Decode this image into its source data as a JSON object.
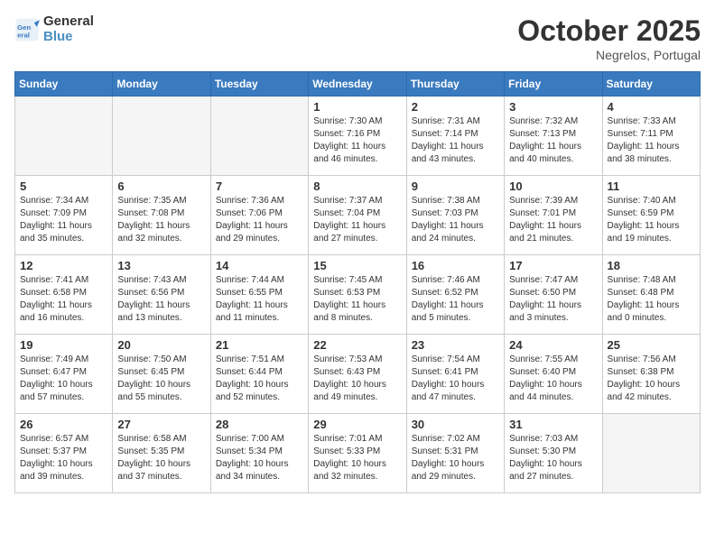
{
  "logo": {
    "line1": "General",
    "line2": "Blue"
  },
  "title": "October 2025",
  "location": "Negrelos, Portugal",
  "weekdays": [
    "Sunday",
    "Monday",
    "Tuesday",
    "Wednesday",
    "Thursday",
    "Friday",
    "Saturday"
  ],
  "weeks": [
    [
      {
        "day": "",
        "info": "",
        "empty": true
      },
      {
        "day": "",
        "info": "",
        "empty": true
      },
      {
        "day": "",
        "info": "",
        "empty": true
      },
      {
        "day": "1",
        "info": "Sunrise: 7:30 AM\nSunset: 7:16 PM\nDaylight: 11 hours\nand 46 minutes."
      },
      {
        "day": "2",
        "info": "Sunrise: 7:31 AM\nSunset: 7:14 PM\nDaylight: 11 hours\nand 43 minutes."
      },
      {
        "day": "3",
        "info": "Sunrise: 7:32 AM\nSunset: 7:13 PM\nDaylight: 11 hours\nand 40 minutes."
      },
      {
        "day": "4",
        "info": "Sunrise: 7:33 AM\nSunset: 7:11 PM\nDaylight: 11 hours\nand 38 minutes."
      }
    ],
    [
      {
        "day": "5",
        "info": "Sunrise: 7:34 AM\nSunset: 7:09 PM\nDaylight: 11 hours\nand 35 minutes."
      },
      {
        "day": "6",
        "info": "Sunrise: 7:35 AM\nSunset: 7:08 PM\nDaylight: 11 hours\nand 32 minutes."
      },
      {
        "day": "7",
        "info": "Sunrise: 7:36 AM\nSunset: 7:06 PM\nDaylight: 11 hours\nand 29 minutes."
      },
      {
        "day": "8",
        "info": "Sunrise: 7:37 AM\nSunset: 7:04 PM\nDaylight: 11 hours\nand 27 minutes."
      },
      {
        "day": "9",
        "info": "Sunrise: 7:38 AM\nSunset: 7:03 PM\nDaylight: 11 hours\nand 24 minutes."
      },
      {
        "day": "10",
        "info": "Sunrise: 7:39 AM\nSunset: 7:01 PM\nDaylight: 11 hours\nand 21 minutes."
      },
      {
        "day": "11",
        "info": "Sunrise: 7:40 AM\nSunset: 6:59 PM\nDaylight: 11 hours\nand 19 minutes."
      }
    ],
    [
      {
        "day": "12",
        "info": "Sunrise: 7:41 AM\nSunset: 6:58 PM\nDaylight: 11 hours\nand 16 minutes."
      },
      {
        "day": "13",
        "info": "Sunrise: 7:43 AM\nSunset: 6:56 PM\nDaylight: 11 hours\nand 13 minutes."
      },
      {
        "day": "14",
        "info": "Sunrise: 7:44 AM\nSunset: 6:55 PM\nDaylight: 11 hours\nand 11 minutes."
      },
      {
        "day": "15",
        "info": "Sunrise: 7:45 AM\nSunset: 6:53 PM\nDaylight: 11 hours\nand 8 minutes."
      },
      {
        "day": "16",
        "info": "Sunrise: 7:46 AM\nSunset: 6:52 PM\nDaylight: 11 hours\nand 5 minutes."
      },
      {
        "day": "17",
        "info": "Sunrise: 7:47 AM\nSunset: 6:50 PM\nDaylight: 11 hours\nand 3 minutes."
      },
      {
        "day": "18",
        "info": "Sunrise: 7:48 AM\nSunset: 6:48 PM\nDaylight: 11 hours\nand 0 minutes."
      }
    ],
    [
      {
        "day": "19",
        "info": "Sunrise: 7:49 AM\nSunset: 6:47 PM\nDaylight: 10 hours\nand 57 minutes."
      },
      {
        "day": "20",
        "info": "Sunrise: 7:50 AM\nSunset: 6:45 PM\nDaylight: 10 hours\nand 55 minutes."
      },
      {
        "day": "21",
        "info": "Sunrise: 7:51 AM\nSunset: 6:44 PM\nDaylight: 10 hours\nand 52 minutes."
      },
      {
        "day": "22",
        "info": "Sunrise: 7:53 AM\nSunset: 6:43 PM\nDaylight: 10 hours\nand 49 minutes."
      },
      {
        "day": "23",
        "info": "Sunrise: 7:54 AM\nSunset: 6:41 PM\nDaylight: 10 hours\nand 47 minutes."
      },
      {
        "day": "24",
        "info": "Sunrise: 7:55 AM\nSunset: 6:40 PM\nDaylight: 10 hours\nand 44 minutes."
      },
      {
        "day": "25",
        "info": "Sunrise: 7:56 AM\nSunset: 6:38 PM\nDaylight: 10 hours\nand 42 minutes."
      }
    ],
    [
      {
        "day": "26",
        "info": "Sunrise: 6:57 AM\nSunset: 5:37 PM\nDaylight: 10 hours\nand 39 minutes."
      },
      {
        "day": "27",
        "info": "Sunrise: 6:58 AM\nSunset: 5:35 PM\nDaylight: 10 hours\nand 37 minutes."
      },
      {
        "day": "28",
        "info": "Sunrise: 7:00 AM\nSunset: 5:34 PM\nDaylight: 10 hours\nand 34 minutes."
      },
      {
        "day": "29",
        "info": "Sunrise: 7:01 AM\nSunset: 5:33 PM\nDaylight: 10 hours\nand 32 minutes."
      },
      {
        "day": "30",
        "info": "Sunrise: 7:02 AM\nSunset: 5:31 PM\nDaylight: 10 hours\nand 29 minutes."
      },
      {
        "day": "31",
        "info": "Sunrise: 7:03 AM\nSunset: 5:30 PM\nDaylight: 10 hours\nand 27 minutes."
      },
      {
        "day": "",
        "info": "",
        "empty": true
      }
    ]
  ]
}
